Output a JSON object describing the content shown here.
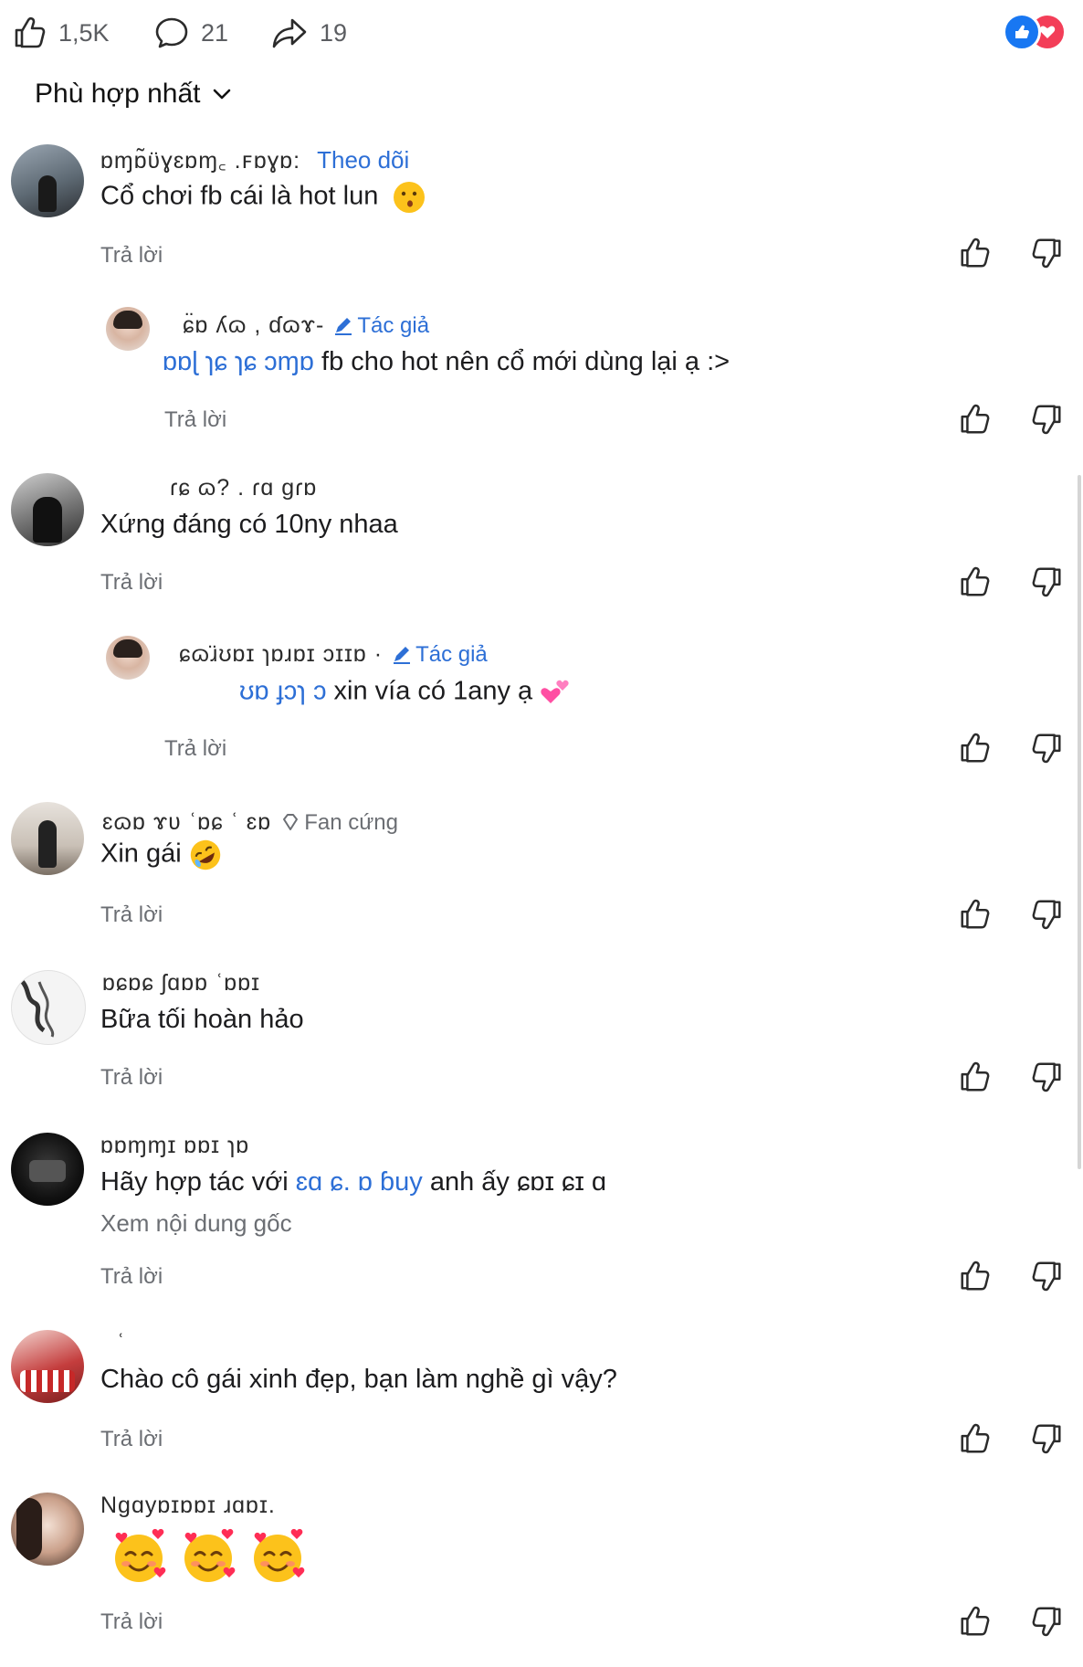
{
  "header": {
    "likes": "1,5K",
    "comments": "21",
    "shares": "19",
    "sort_label": "Phù hợp nhất"
  },
  "colors": {
    "accent_blue": "#2d6fd6",
    "like_blue": "#1877f2",
    "love_red": "#f33e58",
    "muted_text": "#6b6e73"
  },
  "reply_label": "Trả lời",
  "comments": [
    {
      "name": "ɒɱɒ̃ʋ̈ɣɛɒɱ꜀   .ꜰɒɣɒ:",
      "follow": "Theo dõi",
      "text": "Cổ chơi fb cái là hot lun",
      "emoji": "kissing-face-icon"
    },
    {
      "name": "ɕ̈ɒ ʎɷ ,  ɗɷɤ-",
      "badge": "Tác giả",
      "mention": "ɒɒɭ ɿɕ ɿɕ ɔɱɒ",
      "text": " fb cho hot nên cổ mới dùng lại ạ :>"
    },
    {
      "name": "ɾɕ   ɷ?  .   ɾɑ ɡɾɒ",
      "text": "Xứng đáng có 10ny nhaa"
    },
    {
      "name": "ɕɷɹ̈ʊɒɪ ɿɒɹɒɪ ɔɪɪɒ ·",
      "badge": "Tác giả",
      "mention": "ʊɒ ɟɔɿ ɔ",
      "text": " xin vía có 1any ạ",
      "emoji": "two-hearts-icon"
    },
    {
      "name": "ɛɷɒ  ɤʋ   ʿɒɕ    ʿ ɛɒ",
      "badge": "Fan cứng",
      "text": "Xin gái",
      "emoji": "rolling-laughing-face-icon"
    },
    {
      "name": "ɒɕɒɕ ʃɑɒɒ   ʿɒɒɪ",
      "text": "Bữa tối hoàn hảo"
    },
    {
      "name": "ɒɒɱɱɪ ɒɒɪ    ɿɒ",
      "text_prefix": "Hãy hợp tác với ",
      "mention": "ɛɑ  ɕ.  ɒ ɓuy",
      "text_suffix": " anh ấy ɕɒɪ ɕɪ ɑ",
      "see_original": "Xem nội dung gốc"
    },
    {
      "name": "ʿ",
      "text": "Chào cô gái xinh đẹp, bạn làm nghề gì vậy?"
    },
    {
      "name": "Ngɑyɒɪɒɒɪ ɹɑɒɪ.",
      "emojis": [
        "smiling-face-with-hearts-icon",
        "smiling-face-with-hearts-icon",
        "smiling-face-with-hearts-icon"
      ]
    }
  ]
}
